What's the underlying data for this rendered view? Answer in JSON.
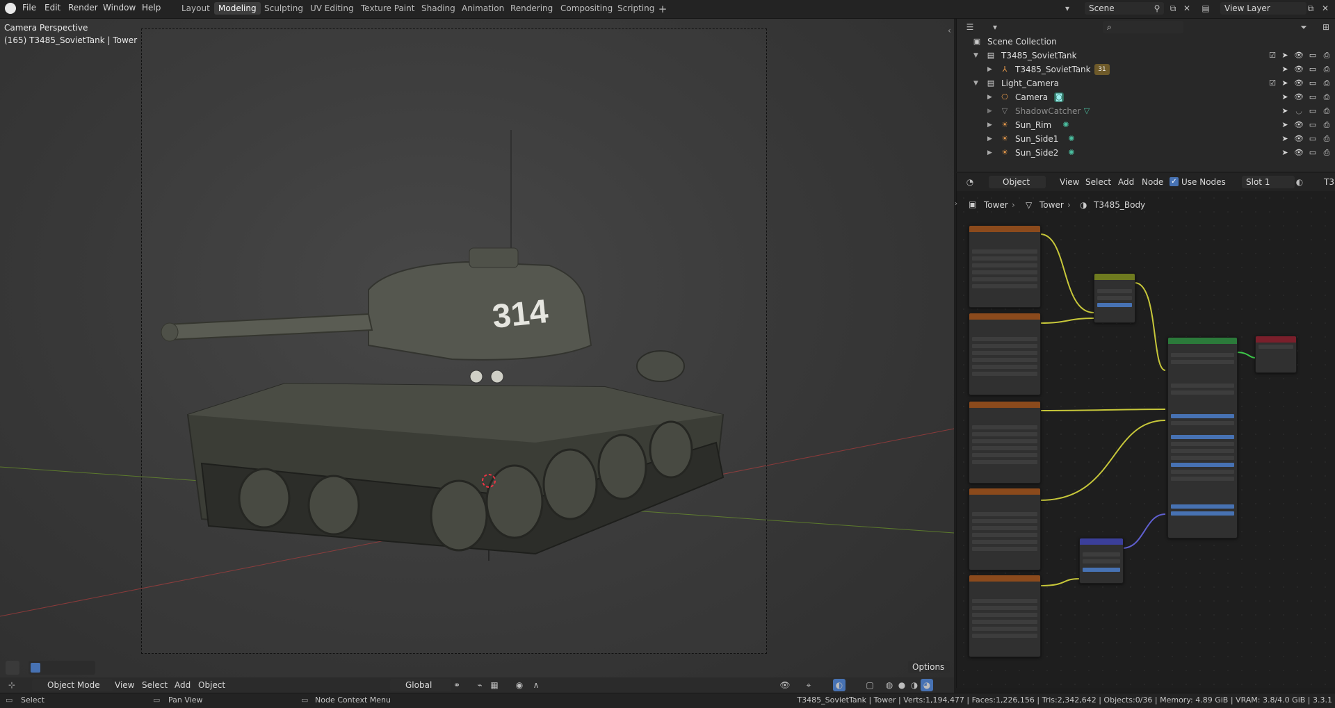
{
  "menu": [
    "File",
    "Edit",
    "Render",
    "Window",
    "Help"
  ],
  "workspaces": [
    "Layout",
    "Modeling",
    "Sculpting",
    "UV Editing",
    "Texture Paint",
    "Shading",
    "Animation",
    "Rendering",
    "Compositing",
    "Scripting"
  ],
  "active_workspace": "Modeling",
  "scene": {
    "value": "Scene"
  },
  "view_layer": {
    "value": "View Layer"
  },
  "viewport": {
    "overlay_line1": "Camera Perspective",
    "overlay_line2": "(165) T3485_SovietTank | Tower",
    "options_label": "Options",
    "mode": "Object Mode",
    "menus": [
      "View",
      "Select",
      "Add",
      "Object"
    ],
    "transform_orientation": "Global",
    "turret_number": "314"
  },
  "outliner": {
    "title": "Scene Collection",
    "rows": [
      {
        "label": "T3485_SovietTank",
        "kind": "collection",
        "indent": 1,
        "expanded": true
      },
      {
        "label": "T3485_SovietTank",
        "kind": "object",
        "indent": 2,
        "badge": "31"
      },
      {
        "label": "Light_Camera",
        "kind": "collection",
        "indent": 1,
        "expanded": true
      },
      {
        "label": "Camera",
        "kind": "camera",
        "indent": 2
      },
      {
        "label": "ShadowCatcher",
        "kind": "mesh",
        "indent": 2,
        "dim": true
      },
      {
        "label": "Sun_Rim",
        "kind": "light",
        "indent": 2
      },
      {
        "label": "Sun_Side1",
        "kind": "light",
        "indent": 2
      },
      {
        "label": "Sun_Side2",
        "kind": "light",
        "indent": 2
      }
    ]
  },
  "node_editor": {
    "type_label": "Object",
    "menus": [
      "View",
      "Select",
      "Add",
      "Node"
    ],
    "use_nodes_label": "Use Nodes",
    "slot": "Slot 1",
    "material_cut": "T3",
    "breadcrumb": [
      "Tower",
      "Tower",
      "T3485_Body"
    ]
  },
  "statusbar": {
    "select": "Select",
    "pan": "Pan View",
    "context": "Node Context Menu",
    "stats": "T3485_SovietTank | Tower | Verts:1,194,477 | Faces:1,226,156 | Tris:2,342,642 | Objects:0/36 | Memory: 4.89 GiB | VRAM: 3.8/4.0 GiB | 3.3.1"
  },
  "colors": {
    "accent": "#4772b3",
    "node_tex": "#8b4a1c",
    "node_mix": "#6e7a1f",
    "node_bsdf": "#2b7a3a",
    "node_out": "#7a1f2b",
    "node_normal": "#3b3f9a",
    "link_yellow": "#c7c73a",
    "link_gray": "#a0a0a0",
    "link_purple": "#6060d0"
  }
}
